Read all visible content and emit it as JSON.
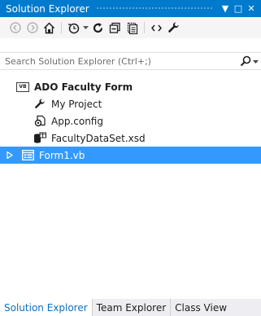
{
  "window": {
    "title": "Solution Explorer",
    "buttons": {
      "dropdown": "▼",
      "maximize": "□",
      "close": "✕"
    }
  },
  "toolbar": {
    "icons": [
      "back-icon",
      "forward-icon",
      "home-icon",
      "pending-changes-icon",
      "dropdown-chevron-icon",
      "refresh-icon",
      "collapse-all-icon",
      "show-all-files-icon",
      "view-code-icon",
      "properties-icon"
    ]
  },
  "search": {
    "placeholder": "Search Solution Explorer (Ctrl+;)",
    "value": ""
  },
  "tree": {
    "project": {
      "label": "ADO Faculty Form",
      "badge": "VB",
      "icon": "vb-project-icon"
    },
    "items": [
      {
        "label": "My Project",
        "icon": "wrench-icon"
      },
      {
        "label": "App.config",
        "icon": "config-file-icon"
      },
      {
        "label": "FacultyDataSet.xsd",
        "icon": "dataset-icon"
      }
    ],
    "selected": {
      "label": "Form1.vb",
      "icon": "form-icon",
      "expander": "expand-arrow-icon"
    }
  },
  "bottom_tabs": [
    {
      "label": "Solution Explorer",
      "active": true
    },
    {
      "label": "Team Explorer",
      "active": false
    },
    {
      "label": "Class View",
      "active": false
    }
  ],
  "colors": {
    "title_bar": "#007acc",
    "selection": "#3399ff",
    "active_tab_text": "#0e70c0"
  }
}
